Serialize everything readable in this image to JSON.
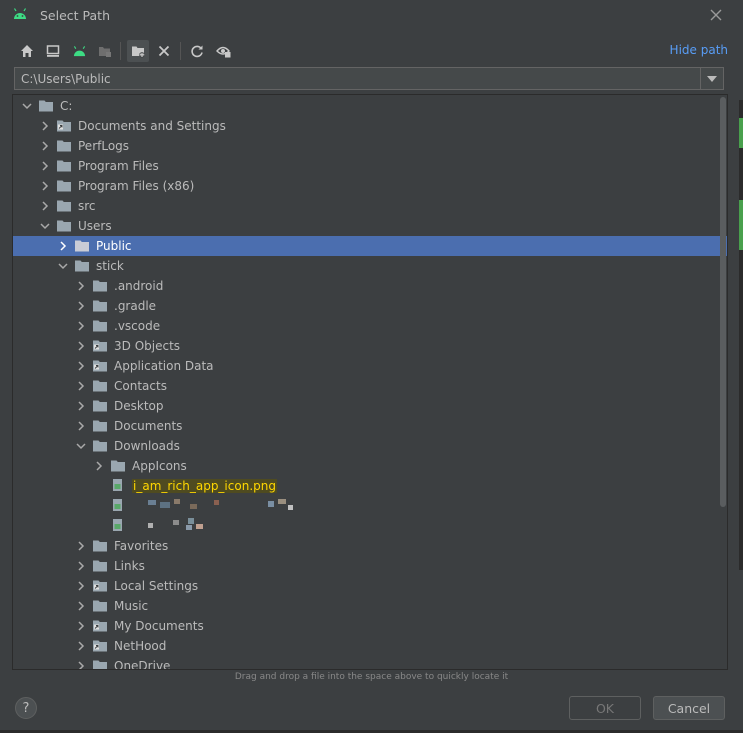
{
  "window": {
    "title": "Select Path"
  },
  "toolbar": {
    "buttons": [
      "home-icon",
      "desktop-icon",
      "android-icon",
      "module-icon",
      "new-folder-icon",
      "delete-icon",
      "refresh-icon",
      "show-hidden-icon"
    ],
    "hide_path_label": "Hide path"
  },
  "path_field": {
    "value": "C:\\Users\\Public"
  },
  "tree": {
    "rows": [
      {
        "label": "C:",
        "depth": 0,
        "expanded": true,
        "icon": "folder"
      },
      {
        "label": "Documents and Settings",
        "depth": 1,
        "expanded": false,
        "icon": "folder-link"
      },
      {
        "label": "PerfLogs",
        "depth": 1,
        "expanded": false,
        "icon": "folder"
      },
      {
        "label": "Program Files",
        "depth": 1,
        "expanded": false,
        "icon": "folder"
      },
      {
        "label": "Program Files (x86)",
        "depth": 1,
        "expanded": false,
        "icon": "folder"
      },
      {
        "label": "src",
        "depth": 1,
        "expanded": false,
        "icon": "folder"
      },
      {
        "label": "Users",
        "depth": 1,
        "expanded": true,
        "icon": "folder"
      },
      {
        "label": "Public",
        "depth": 2,
        "expanded": false,
        "icon": "folder",
        "selected": true
      },
      {
        "label": "stick",
        "depth": 2,
        "expanded": true,
        "icon": "folder"
      },
      {
        "label": ".android",
        "depth": 3,
        "expanded": false,
        "icon": "folder"
      },
      {
        "label": ".gradle",
        "depth": 3,
        "expanded": false,
        "icon": "folder"
      },
      {
        "label": ".vscode",
        "depth": 3,
        "expanded": false,
        "icon": "folder"
      },
      {
        "label": "3D Objects",
        "depth": 3,
        "expanded": false,
        "icon": "folder-link"
      },
      {
        "label": "Application Data",
        "depth": 3,
        "expanded": false,
        "icon": "folder-link"
      },
      {
        "label": "Contacts",
        "depth": 3,
        "expanded": false,
        "icon": "folder"
      },
      {
        "label": "Desktop",
        "depth": 3,
        "expanded": false,
        "icon": "folder"
      },
      {
        "label": "Documents",
        "depth": 3,
        "expanded": false,
        "icon": "folder"
      },
      {
        "label": "Downloads",
        "depth": 3,
        "expanded": true,
        "icon": "folder"
      },
      {
        "label": "AppIcons",
        "depth": 4,
        "expanded": false,
        "icon": "folder"
      },
      {
        "label": "i_am_rich_app_icon.png",
        "depth": 4,
        "leaf": true,
        "icon": "image-file",
        "highlight": true
      },
      {
        "label": "",
        "depth": 4,
        "leaf": true,
        "icon": "image-file",
        "blurred": true
      },
      {
        "label": "",
        "depth": 4,
        "leaf": true,
        "icon": "image-file",
        "blurred": true
      },
      {
        "label": "Favorites",
        "depth": 3,
        "expanded": false,
        "icon": "folder"
      },
      {
        "label": "Links",
        "depth": 3,
        "expanded": false,
        "icon": "folder"
      },
      {
        "label": "Local Settings",
        "depth": 3,
        "expanded": false,
        "icon": "folder-link"
      },
      {
        "label": "Music",
        "depth": 3,
        "expanded": false,
        "icon": "folder"
      },
      {
        "label": "My Documents",
        "depth": 3,
        "expanded": false,
        "icon": "folder-link"
      },
      {
        "label": "NetHood",
        "depth": 3,
        "expanded": false,
        "icon": "folder-link"
      },
      {
        "label": "OneDrive",
        "depth": 3,
        "expanded": false,
        "icon": "folder"
      }
    ]
  },
  "hint": "Drag and drop a file into the space above to quickly locate it",
  "help_label": "?",
  "buttons": {
    "ok": "OK",
    "cancel": "Cancel"
  },
  "colors": {
    "background": "#3c3f41",
    "selection": "#4b6eaf",
    "link": "#589df6",
    "highlight": "#ffd700"
  }
}
